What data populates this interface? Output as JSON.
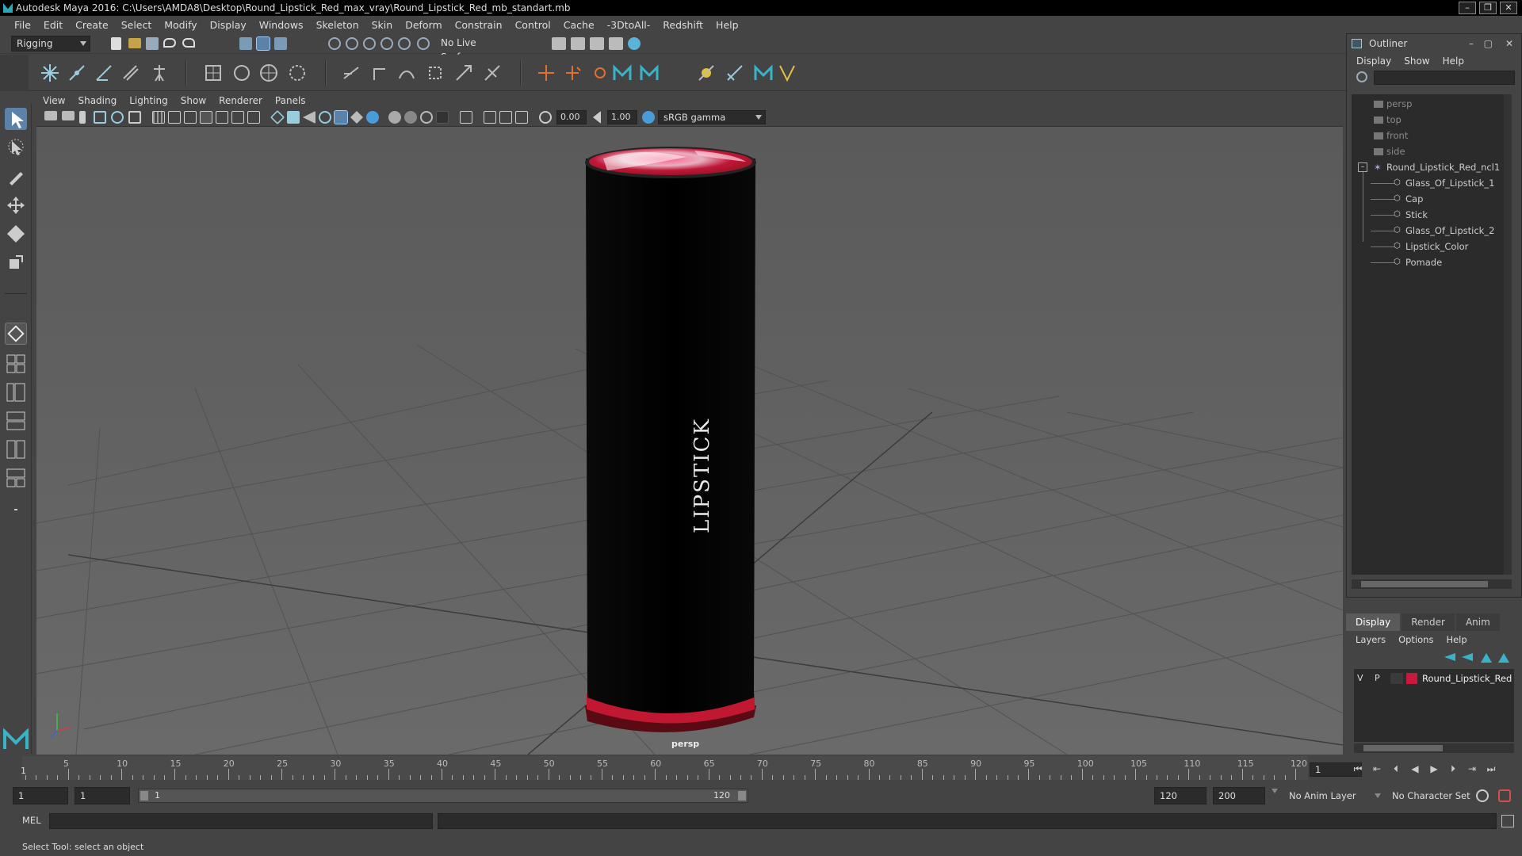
{
  "window": {
    "title": "Autodesk Maya 2016: C:\\Users\\AMDA8\\Desktop\\Round_Lipstick_Red_max_vray\\Round_Lipstick_Red_mb_standart.mb",
    "minimize": "–",
    "maximize": "❐",
    "close": "✕"
  },
  "menubar": [
    "File",
    "Edit",
    "Create",
    "Select",
    "Modify",
    "Display",
    "Windows",
    "Skeleton",
    "Skin",
    "Deform",
    "Constrain",
    "Control",
    "Cache",
    "-3DtoAll-",
    "Redshift",
    "Help"
  ],
  "statusline": {
    "mode": "Rigging",
    "live_surface": "No Live Surface"
  },
  "panel": {
    "menu": [
      "View",
      "Shading",
      "Lighting",
      "Show",
      "Renderer",
      "Panels"
    ],
    "exposure": "0.00",
    "gamma": "1.00",
    "color_space": "sRGB gamma",
    "camera_label": "persp",
    "product_label": "LIPSTICK"
  },
  "outliner": {
    "title": "Outliner",
    "menu": [
      "Display",
      "Show",
      "Help"
    ],
    "items": [
      {
        "label": "persp",
        "kind": "camera"
      },
      {
        "label": "top",
        "kind": "camera"
      },
      {
        "label": "front",
        "kind": "camera"
      },
      {
        "label": "side",
        "kind": "camera"
      },
      {
        "label": "Round_Lipstick_Red_ncl1",
        "kind": "group"
      },
      {
        "label": "Glass_Of_Lipstick_1",
        "kind": "mesh"
      },
      {
        "label": "Cap",
        "kind": "mesh"
      },
      {
        "label": "Stick",
        "kind": "mesh"
      },
      {
        "label": "Glass_Of_Lipstick_2",
        "kind": "mesh"
      },
      {
        "label": "Lipstick_Color",
        "kind": "mesh"
      },
      {
        "label": "Pomade",
        "kind": "mesh"
      }
    ]
  },
  "layers": {
    "tabs": [
      "Display",
      "Render",
      "Anim"
    ],
    "menu": [
      "Layers",
      "Options",
      "Help"
    ],
    "rows": [
      {
        "v": "V",
        "p": "P",
        "name": "Round_Lipstick_Red",
        "color": "#c8183c"
      }
    ]
  },
  "timeslider": {
    "labels": [
      "5",
      "10",
      "15",
      "20",
      "25",
      "30",
      "35",
      "40",
      "45",
      "50",
      "55",
      "60",
      "65",
      "70",
      "75",
      "80",
      "85",
      "90",
      "95",
      "100",
      "105",
      "110",
      "115",
      "120"
    ],
    "first_frame": "1",
    "current_frame": "1"
  },
  "range": {
    "start_a": "1",
    "start_b": "1",
    "slider_start": "1",
    "slider_end": "120",
    "end": "120",
    "end_total": "200",
    "anim_layer": "No Anim Layer",
    "char_set": "No Character Set"
  },
  "cmdline": {
    "label": "MEL"
  },
  "helpline": {
    "text": "Select Tool: select an object"
  }
}
